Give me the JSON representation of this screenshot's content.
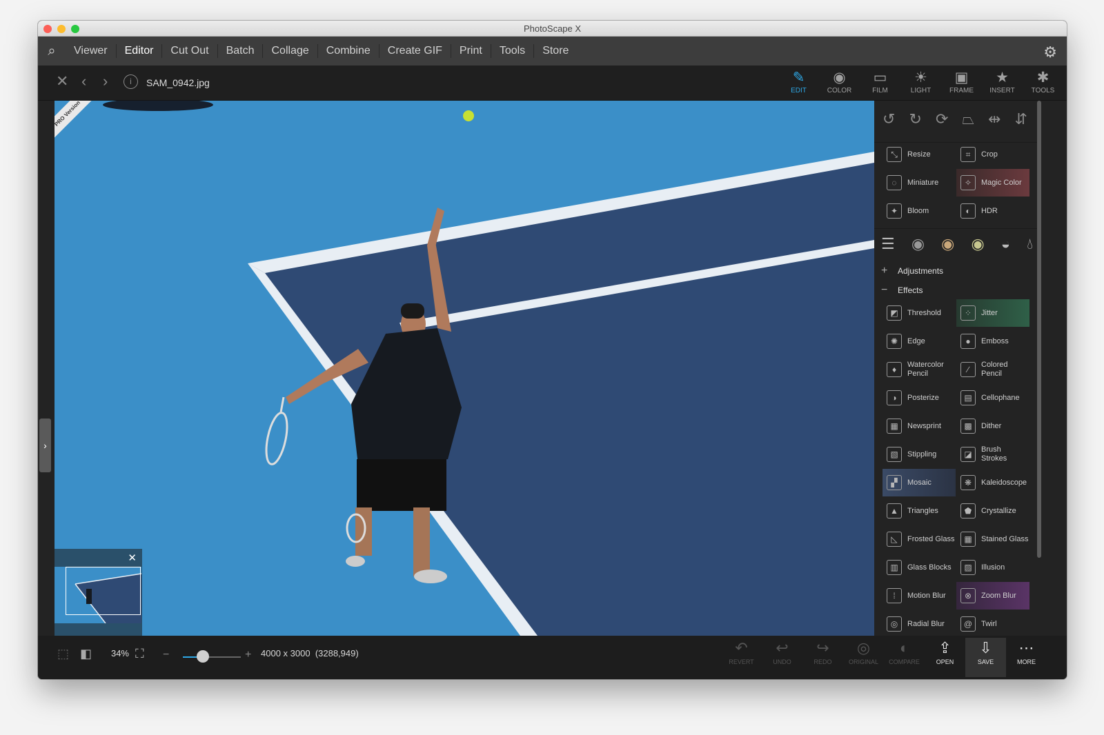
{
  "window": {
    "title": "PhotoScape X"
  },
  "menu": [
    "Viewer",
    "Editor",
    "Cut Out",
    "Batch",
    "Collage",
    "Combine",
    "Create GIF",
    "Print",
    "Tools",
    "Store"
  ],
  "menu_active": "Editor",
  "toolbar": {
    "filename": "SAM_0942.jpg"
  },
  "tabs": [
    {
      "label": "EDIT",
      "icon": "edit-icon"
    },
    {
      "label": "COLOR",
      "icon": "color-icon"
    },
    {
      "label": "FILM",
      "icon": "film-icon"
    },
    {
      "label": "LIGHT",
      "icon": "light-icon"
    },
    {
      "label": "FRAME",
      "icon": "frame-icon"
    },
    {
      "label": "INSERT",
      "icon": "insert-icon"
    },
    {
      "label": "TOOLS",
      "icon": "tools-icon"
    }
  ],
  "active_tab": "EDIT",
  "image": {
    "badge": "PRO Version"
  },
  "panel": {
    "top_tools": [
      {
        "label": "Resize",
        "icon": "resize-icon"
      },
      {
        "label": "Crop",
        "icon": "crop-icon"
      },
      {
        "label": "Miniature",
        "icon": "miniature-icon"
      },
      {
        "label": "Magic Color",
        "icon": "magic-color-icon"
      },
      {
        "label": "Bloom",
        "icon": "bloom-icon"
      },
      {
        "label": "HDR",
        "icon": "hdr-icon"
      }
    ],
    "adjustments": "Adjustments",
    "effects_title": "Effects",
    "effects": [
      {
        "label": "Threshold",
        "icon": "threshold-icon"
      },
      {
        "label": "Jitter",
        "icon": "jitter-icon"
      },
      {
        "label": "Edge",
        "icon": "edge-icon"
      },
      {
        "label": "Emboss",
        "icon": "emboss-icon"
      },
      {
        "label": "Watercolor Pencil",
        "icon": "watercolor-pencil-icon"
      },
      {
        "label": "Colored Pencil",
        "icon": "colored-pencil-icon"
      },
      {
        "label": "Posterize",
        "icon": "posterize-icon"
      },
      {
        "label": "Cellophane",
        "icon": "cellophane-icon"
      },
      {
        "label": "Newsprint",
        "icon": "newsprint-icon"
      },
      {
        "label": "Dither",
        "icon": "dither-icon"
      },
      {
        "label": "Stippling",
        "icon": "stippling-icon"
      },
      {
        "label": "Brush Strokes",
        "icon": "brush-strokes-icon"
      },
      {
        "label": "Mosaic",
        "icon": "mosaic-icon"
      },
      {
        "label": "Kaleidoscope",
        "icon": "kaleidoscope-icon"
      },
      {
        "label": "Triangles",
        "icon": "triangles-icon"
      },
      {
        "label": "Crystallize",
        "icon": "crystallize-icon"
      },
      {
        "label": "Frosted Glass",
        "icon": "frosted-glass-icon"
      },
      {
        "label": "Stained Glass",
        "icon": "stained-glass-icon"
      },
      {
        "label": "Glass Blocks",
        "icon": "glass-blocks-icon"
      },
      {
        "label": "Illusion",
        "icon": "illusion-icon"
      },
      {
        "label": "Motion Blur",
        "icon": "motion-blur-icon"
      },
      {
        "label": "Zoom Blur",
        "icon": "zoom-blur-icon"
      },
      {
        "label": "Radial Blur",
        "icon": "radial-blur-icon"
      },
      {
        "label": "Twirl",
        "icon": "twirl-icon"
      }
    ]
  },
  "status": {
    "zoom": "34%",
    "zoom_fraction": 0.34,
    "dimensions": "4000 x 3000",
    "cursor": "(3288,949)"
  },
  "actions": [
    {
      "label": "REVERT",
      "icon": "revert-icon",
      "enabled": false
    },
    {
      "label": "UNDO",
      "icon": "undo-icon",
      "enabled": false
    },
    {
      "label": "REDO",
      "icon": "redo-icon",
      "enabled": false
    },
    {
      "label": "ORIGINAL",
      "icon": "original-icon",
      "enabled": false
    },
    {
      "label": "COMPARE",
      "icon": "compare-icon",
      "enabled": false
    },
    {
      "label": "OPEN",
      "icon": "open-icon",
      "enabled": true
    },
    {
      "label": "SAVE",
      "icon": "save-icon",
      "enabled": true
    },
    {
      "label": "MORE",
      "icon": "more-icon",
      "enabled": true
    }
  ],
  "colors": {
    "accent": "#2ea8e6",
    "court_light": "#3b8fc8",
    "court_dark": "#2f4a74",
    "panel": "#232323"
  }
}
